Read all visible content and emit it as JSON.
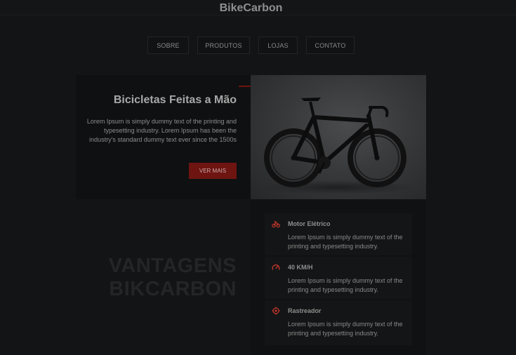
{
  "brand": "BikeCarbon",
  "nav": {
    "items": [
      "SOBRE",
      "PRODUTOS",
      "LOJAS",
      "CONTATO"
    ]
  },
  "hero": {
    "title": "Bicicletas Feitas a Mão",
    "text": "Lorem Ipsum is simply dummy text of the printing and typesetting industry. Lorem Ipsum has been the industry's standard dummy text ever since the 1500s",
    "cta": "VER MAIS"
  },
  "advantages": {
    "heading_line1": "VANTAGENS",
    "heading_line2": "BIKCARBON"
  },
  "features": [
    {
      "icon": "motorbike-icon",
      "title": "Motor Elétrico",
      "text": "Lorem Ipsum is simply dummy text of the printing and typesetting industry."
    },
    {
      "icon": "speedometer-icon",
      "title": "40 KM/H",
      "text": "Lorem Ipsum is simply dummy text of the printing and typesetting industry."
    },
    {
      "icon": "location-target-icon",
      "title": "Rastreador",
      "text": "Lorem Ipsum is simply dummy text of the printing and typesetting industry."
    }
  ],
  "colors": {
    "background": "#131415",
    "accent": "#6e1411",
    "icon_red": "#c0362c"
  }
}
